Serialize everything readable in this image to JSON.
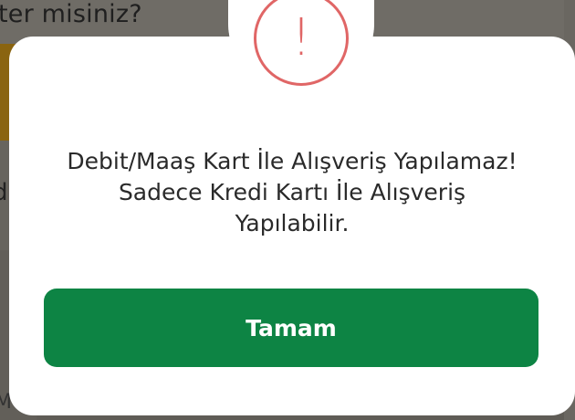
{
  "background": {
    "question_text": "ter misiniz?",
    "side_letter": "d",
    "bottom_letter": "M"
  },
  "dialog": {
    "icon": "alert-icon",
    "icon_glyph": "!",
    "message_lines": [
      "Debit/Maaş Kart İle Alışveriş Yapılamaz!",
      "Sadece Kredi Kartı İle Alışveriş",
      "Yapılabilir."
    ],
    "ok_label": "Tamam"
  },
  "colors": {
    "accent_green": "#0d8444",
    "alert_red": "#e06666"
  }
}
